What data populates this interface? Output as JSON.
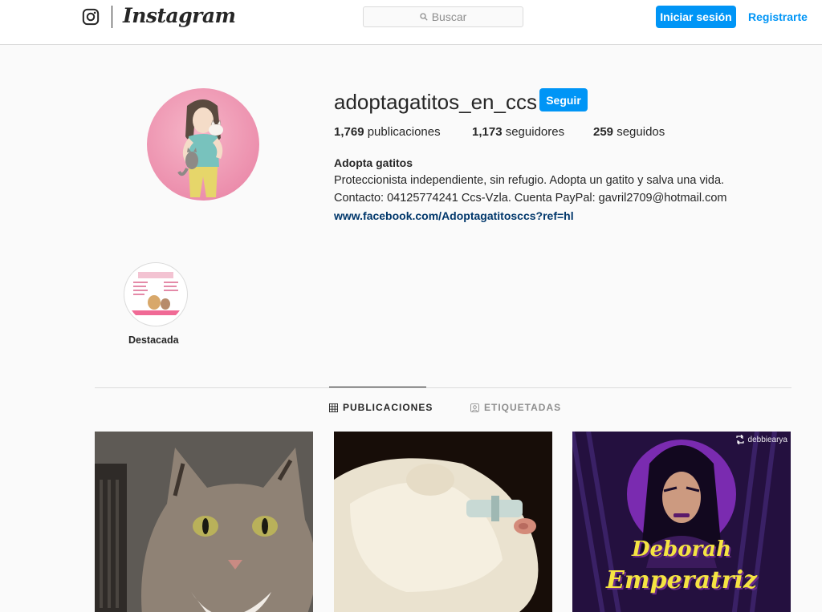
{
  "nav": {
    "wordmark": "Instagram",
    "search_placeholder": "Buscar",
    "login_label": "Iniciar sesión",
    "register_label": "Registrarte",
    "icons": [
      "instagram-glyph-icon",
      "search-icon"
    ],
    "accent_color": "#0095f6"
  },
  "profile": {
    "username": "adoptagatitos_en_ccs",
    "follow_label": "Seguir",
    "stats": {
      "posts_count": "1,769",
      "posts_label": "publicaciones",
      "followers_count": "1,173",
      "followers_label": "seguidores",
      "following_count": "259",
      "following_label": "seguidos"
    },
    "bio": {
      "name": "Adopta gatitos",
      "line1": "Proteccionista independiente, sin refugio. Adopta un gatito y salva una vida.",
      "line2": "Contacto: 04125774241 Ccs-Vzla. Cuenta PayPal: gavril2709@hotmail.com",
      "link": "www.facebook.com/Adoptagatitosccs?ref=hl"
    }
  },
  "highlight": {
    "label": "Destacada"
  },
  "tabs": {
    "posts_label": "PUBLICACIONES",
    "tagged_label": "ETIQUETADAS",
    "active": "posts"
  },
  "posts": {
    "post3_repost_user": "debbiearya",
    "post3_title_line1": "Deborah",
    "post3_title_line2": "Emperatriz"
  }
}
